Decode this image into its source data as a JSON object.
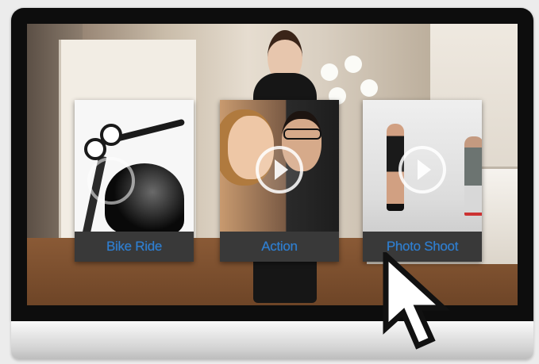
{
  "videos": [
    {
      "label": "Bike Ride",
      "thumbnail": "motorcycle-icon",
      "play_control": "play-icon"
    },
    {
      "label": "Action",
      "thumbnail": "couple-selfie",
      "play_control": "play-icon"
    },
    {
      "label": "Photo Shoot",
      "thumbnail": "studio-photoshoot",
      "play_control": "play-icon"
    }
  ],
  "cursor": "arrow-pointer-icon",
  "colors": {
    "caption_text": "#2f7fd1",
    "caption_bg": "#282828",
    "bezel": "#0d0d0d"
  }
}
